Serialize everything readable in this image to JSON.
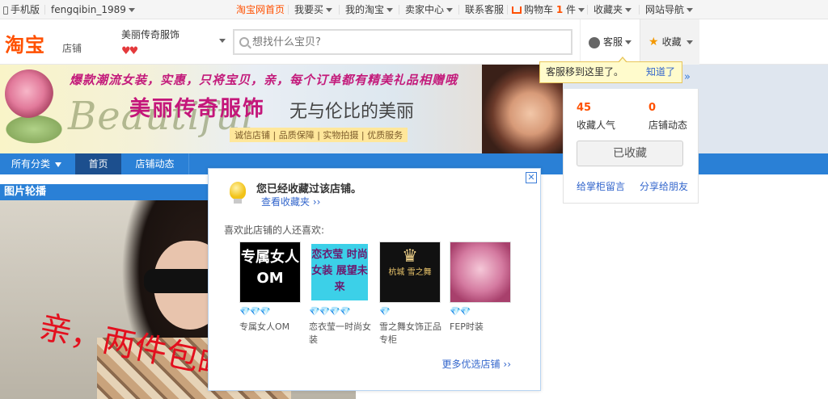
{
  "topbar": {
    "mobile": "手机版",
    "username": "fengqibin_1989",
    "home": "淘宝网首页",
    "buy": "我要买",
    "my_taobao": "我的淘宝",
    "seller": "卖家中心",
    "service": "联系客服",
    "cart": "购物车",
    "cart_count": "1",
    "cart_unit": "件",
    "favorites": "收藏夹",
    "site_nav": "网站导航"
  },
  "header": {
    "logo": "淘宝",
    "logo_sub": "店铺",
    "shop_name": "美丽传奇服饰",
    "hearts": "♥♥",
    "search_placeholder": "想找什么宝贝?",
    "service_btn": "客服",
    "fav_btn": "收藏"
  },
  "banner": {
    "slogan": "爆款潮流女装，实惠，只将宝贝，亲，每个订单都有精美礼品相赠哦",
    "brand_en": "Beautiful",
    "brand": "美丽传奇服饰",
    "brand_sub": "无与伦比的美丽",
    "tags": "诚信店铺 | 品质保障 | 实物拍摄 | 优质服务"
  },
  "nav": {
    "all": "所有分类",
    "home": "首页",
    "news": "店铺动态"
  },
  "carousel": {
    "title": "图片轮播",
    "overlay_text": "亲，两件包邮啦"
  },
  "tooltip": {
    "text": "客服移到这里了。",
    "ok": "知道了"
  },
  "fav_panel": {
    "popularity_value": "45",
    "popularity_label": "收藏人气",
    "dynamics_value": "0",
    "dynamics_label": "店铺动态",
    "collected_btn": "已收藏",
    "message": "给掌柜留言",
    "share": "分享给朋友"
  },
  "popup": {
    "title": "您已经收藏过该店铺。",
    "view_fav": "查看收藏夹",
    "also_like": "喜欢此店铺的人还喜欢:",
    "shops": [
      {
        "thumb": "专属女人OM",
        "diamonds": "💎💎💎",
        "name": "专属女人OM"
      },
      {
        "thumb": "恋衣莹 时尚女装 展望未来",
        "diamonds": "💎💎💎💎",
        "name": "恋衣莹一时尚女装"
      },
      {
        "thumb": "杭城 雪之舞",
        "diamonds": "💎",
        "name": "雪之舞女饰正品专柜"
      },
      {
        "thumb": "",
        "diamonds": "💎💎",
        "name": "FEP时装"
      }
    ],
    "more": "更多优选店铺"
  },
  "colors": {
    "nav_blue": "#2a80d6",
    "nav_active": "#1c4f8e",
    "accent_orange": "#ff5000",
    "link_blue": "#3366cc"
  }
}
